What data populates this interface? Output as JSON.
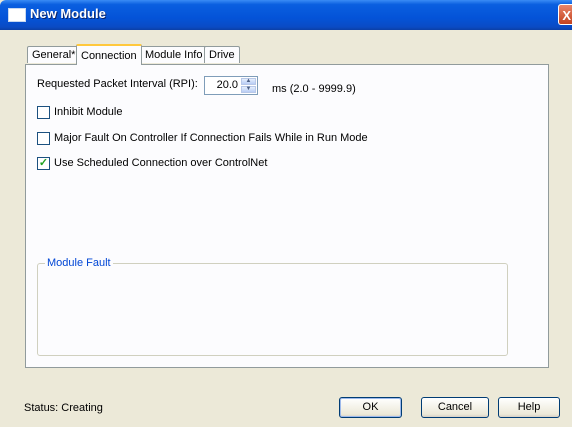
{
  "window": {
    "title": "New Module",
    "close_glyph": "X"
  },
  "tabs": [
    {
      "label": "General*"
    },
    {
      "label": "Connection"
    },
    {
      "label": "Module Info"
    },
    {
      "label": "Drive"
    }
  ],
  "connection": {
    "rpi_label": "Requested Packet Interval (RPI):",
    "rpi_value": "20.0",
    "rpi_range": "ms (2.0 - 9999.9)",
    "options": [
      {
        "label": "Inhibit Module",
        "checked": false
      },
      {
        "label": "Major Fault On Controller If Connection Fails While in Run Mode",
        "checked": false
      },
      {
        "label": "Use Scheduled Connection over ControlNet",
        "checked": true
      }
    ],
    "module_fault_label": "Module Fault"
  },
  "footer": {
    "status": "Status:  Creating",
    "ok_label": "OK",
    "cancel_label": "Cancel",
    "help_label": "Help"
  },
  "colors": {
    "titlebar": "#0453d8",
    "active_tab_accent": "#ffc83c",
    "group_label": "#0046d5",
    "checkmark": "#21a121"
  }
}
